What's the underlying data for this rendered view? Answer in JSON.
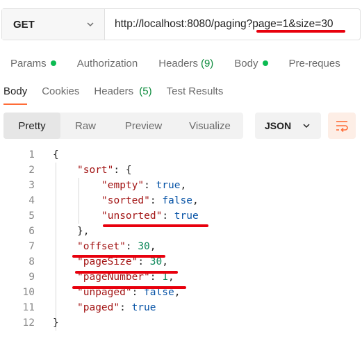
{
  "request": {
    "method": "GET",
    "url": "http://localhost:8080/paging?page=1&size=30"
  },
  "request_tabs": [
    {
      "label": "Params",
      "dot": true
    },
    {
      "label": "Authorization"
    },
    {
      "label": "Headers",
      "count": "(9)"
    },
    {
      "label": "Body",
      "dot": true
    },
    {
      "label": "Pre-reques"
    }
  ],
  "response_tabs": [
    {
      "label": "Body",
      "count": "",
      "active": true
    },
    {
      "label": "Cookies",
      "count": ""
    },
    {
      "label": "Headers",
      "count": "(5)"
    },
    {
      "label": "Test Results",
      "count": ""
    }
  ],
  "view_modes": [
    "Pretty",
    "Raw",
    "Preview",
    "Visualize"
  ],
  "active_view_mode": "Pretty",
  "format": "JSON",
  "colors": {
    "accent": "#ff6c37",
    "status_dot": "#0cbb52",
    "annotation_red": "#e8000d",
    "json_key": "#a31515",
    "json_number": "#098658",
    "json_bool": "#0451a5"
  },
  "icons": {
    "method_dropdown": "chevron-down-icon",
    "format_dropdown": "chevron-down-icon",
    "wrap": "wrap-lines-icon"
  },
  "code_lines": [
    {
      "num": "1",
      "parts": [
        {
          "t": "{",
          "c": "p"
        }
      ]
    },
    {
      "num": "2",
      "parts": [
        {
          "t": "\"sort\"",
          "c": "k"
        },
        {
          "t": ": {",
          "c": "p"
        }
      ]
    },
    {
      "num": "3",
      "parts": [
        {
          "t": "\"empty\"",
          "c": "k"
        },
        {
          "t": ": ",
          "c": "p"
        },
        {
          "t": "true",
          "c": "b"
        },
        {
          "t": ",",
          "c": "p"
        }
      ]
    },
    {
      "num": "4",
      "parts": [
        {
          "t": "\"sorted\"",
          "c": "k"
        },
        {
          "t": ": ",
          "c": "p"
        },
        {
          "t": "false",
          "c": "b"
        },
        {
          "t": ",",
          "c": "p"
        }
      ]
    },
    {
      "num": "5",
      "parts": [
        {
          "t": "\"unsorted\"",
          "c": "k"
        },
        {
          "t": ": ",
          "c": "p"
        },
        {
          "t": "true",
          "c": "b"
        }
      ]
    },
    {
      "num": "6",
      "parts": [
        {
          "t": "},",
          "c": "p"
        }
      ]
    },
    {
      "num": "7",
      "parts": [
        {
          "t": "\"offset\"",
          "c": "k"
        },
        {
          "t": ": ",
          "c": "p"
        },
        {
          "t": "30",
          "c": "n"
        },
        {
          "t": ",",
          "c": "p"
        }
      ]
    },
    {
      "num": "8",
      "parts": [
        {
          "t": "\"pageSize\"",
          "c": "k"
        },
        {
          "t": ": ",
          "c": "p"
        },
        {
          "t": "30",
          "c": "n"
        },
        {
          "t": ",",
          "c": "p"
        }
      ]
    },
    {
      "num": "9",
      "parts": [
        {
          "t": "\"pageNumber\"",
          "c": "k"
        },
        {
          "t": ": ",
          "c": "p"
        },
        {
          "t": "1",
          "c": "n"
        },
        {
          "t": ",",
          "c": "p"
        }
      ]
    },
    {
      "num": "10",
      "parts": [
        {
          "t": "\"unpaged\"",
          "c": "k"
        },
        {
          "t": ": ",
          "c": "p"
        },
        {
          "t": "false",
          "c": "b"
        },
        {
          "t": ",",
          "c": "p"
        }
      ]
    },
    {
      "num": "11",
      "parts": [
        {
          "t": "\"paged\"",
          "c": "k"
        },
        {
          "t": ": ",
          "c": "p"
        },
        {
          "t": "true",
          "c": "b"
        }
      ]
    },
    {
      "num": "12",
      "parts": [
        {
          "t": "}",
          "c": "p"
        }
      ]
    }
  ]
}
